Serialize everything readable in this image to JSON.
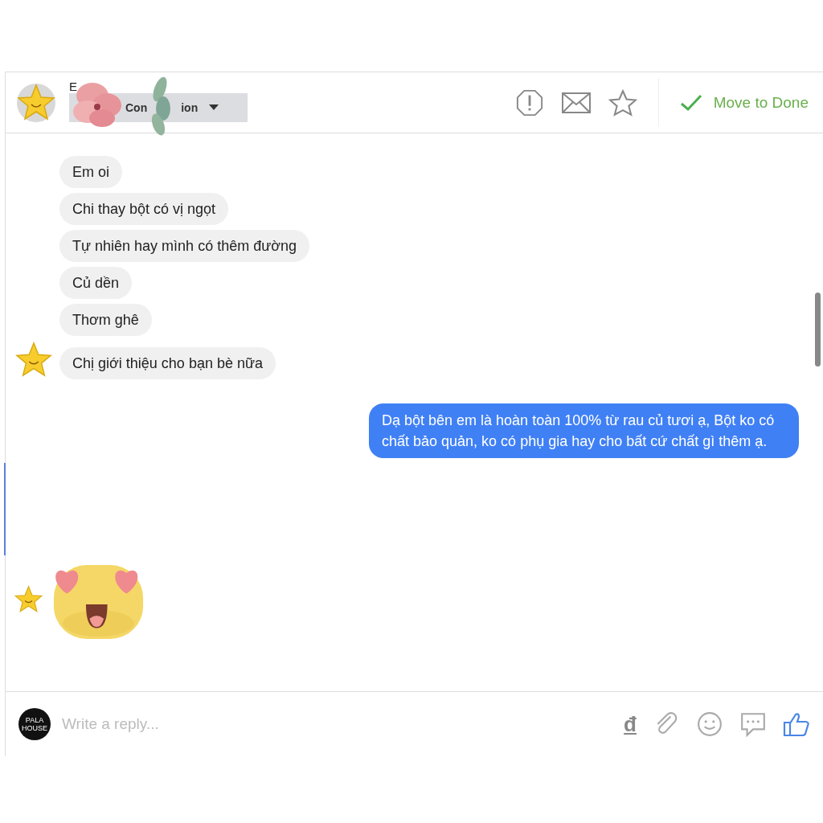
{
  "header": {
    "contact_name": "E",
    "dropdown": {
      "label_parts": [
        "Con",
        "ion"
      ]
    },
    "action": {
      "label": "Move to Done"
    }
  },
  "messages": [
    {
      "kind": "text",
      "outgoing": false,
      "avatar": false,
      "text": "Em oi"
    },
    {
      "kind": "text",
      "outgoing": false,
      "avatar": false,
      "text": "Chi thay bột có vị ngọt"
    },
    {
      "kind": "text",
      "outgoing": false,
      "avatar": false,
      "text": "Tự nhiên hay mình có thêm đường"
    },
    {
      "kind": "text",
      "outgoing": false,
      "avatar": false,
      "text": "Củ dền"
    },
    {
      "kind": "text",
      "outgoing": false,
      "avatar": false,
      "text": "Thơm ghê"
    },
    {
      "kind": "text",
      "outgoing": false,
      "avatar": true,
      "text": "Chị giới thiệu cho bạn bè nữa"
    },
    {
      "kind": "text",
      "outgoing": true,
      "avatar": false,
      "text": "Dạ bột bên em là hoàn toàn 100% từ rau củ tươi ạ, Bột ko có chất bảo quản, ko có phụ gia hay cho bất cứ chất gì thêm ạ."
    },
    {
      "kind": "sticker",
      "outgoing": false,
      "avatar": true
    }
  ],
  "composer": {
    "avatar_lines": [
      "PALA",
      "HOUSE"
    ],
    "placeholder": "Write a reply...",
    "currency_symbol": "đ"
  }
}
